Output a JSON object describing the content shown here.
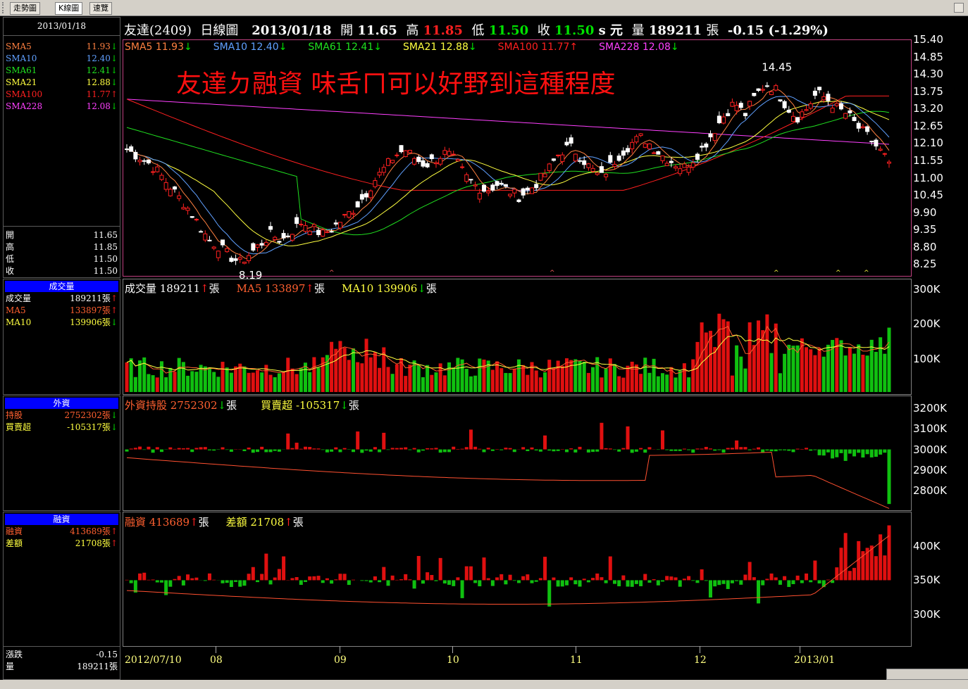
{
  "tabs": [
    {
      "label": "走勢圖",
      "active": false
    },
    {
      "label": "K線圖",
      "active": true
    },
    {
      "label": "速覽",
      "active": false
    }
  ],
  "header": {
    "stock": "友達(2409)",
    "period": "日線圖",
    "date": "2013/01/18",
    "open_label": "開",
    "open": "11.65",
    "high_label": "高",
    "high": "11.85",
    "low_label": "低",
    "low": "11.50",
    "close_label": "收",
    "close": "11.50",
    "unit": "s 元",
    "vol_label": "量",
    "volume": "189211",
    "vol_unit": "張",
    "change": "-0.15 (-1.29%)"
  },
  "overlay_text": "友達ㄉ融資 味舌ㄇ可以好野到這種程度",
  "sidebar": {
    "date": "2013/01/18",
    "sma": [
      {
        "name": "SMA5",
        "value": "11.93",
        "dir": "down",
        "color": "#ff8040"
      },
      {
        "name": "SMA10",
        "value": "12.40",
        "dir": "down",
        "color": "#60a0ff"
      },
      {
        "name": "SMA61",
        "value": "12.41",
        "dir": "down",
        "color": "#20e020"
      },
      {
        "name": "SMA21",
        "value": "12.88",
        "dir": "down",
        "color": "#ffff40"
      },
      {
        "name": "SMA100",
        "value": "11.77",
        "dir": "up",
        "color": "#ff2020"
      },
      {
        "name": "SMA228",
        "value": "12.08",
        "dir": "down",
        "color": "#ff40ff"
      }
    ],
    "ohlc": [
      {
        "k": "開",
        "v": "11.65"
      },
      {
        "k": "高",
        "v": "11.85"
      },
      {
        "k": "低",
        "v": "11.50"
      },
      {
        "k": "收",
        "v": "11.50"
      }
    ],
    "vol_title": "成交量",
    "vol": [
      {
        "k": "成交量",
        "v": "189211張",
        "dir": "up",
        "color": "#ffffff"
      },
      {
        "k": "MA5",
        "v": "133897張",
        "dir": "up",
        "color": "#ff6030"
      },
      {
        "k": "MA10",
        "v": "139906張",
        "dir": "down",
        "color": "#ffff40"
      }
    ],
    "foreign_title": "外資",
    "foreign": [
      {
        "k": "持股",
        "v": "2752302張",
        "dir": "down",
        "color": "#ff6030"
      },
      {
        "k": "買賣超",
        "v": "-105317張",
        "dir": "down",
        "color": "#ffff40"
      }
    ],
    "margin_title": "融資",
    "margin": [
      {
        "k": "融資",
        "v": "413689張",
        "dir": "up",
        "color": "#ff6030"
      },
      {
        "k": "差額",
        "v": "21708張",
        "dir": "up",
        "color": "#ffff40"
      }
    ],
    "bottom": [
      {
        "k": "漲跌",
        "v": "-0.15"
      },
      {
        "k": "量",
        "v": "189211張"
      }
    ]
  },
  "legends": {
    "sma_top": [
      {
        "text": "SMA5 11.93",
        "dir": "down",
        "color": "#ff8040"
      },
      {
        "text": "SMA10 12.40",
        "dir": "down",
        "color": "#60a0ff"
      },
      {
        "text": "SMA61 12.41",
        "dir": "down",
        "color": "#20e020"
      },
      {
        "text": "SMA21 12.88",
        "dir": "down",
        "color": "#ffff40"
      },
      {
        "text": "SMA100 11.77",
        "dir": "up",
        "color": "#ff2020"
      },
      {
        "text": "SMA228 12.08",
        "dir": "down",
        "color": "#ff40ff"
      }
    ],
    "vol": [
      {
        "text": "成交量 189211",
        "dir": "up",
        "unit": "張",
        "color": "#ffffff"
      },
      {
        "text": "MA5 133897",
        "dir": "up",
        "unit": "張",
        "color": "#ff6030"
      },
      {
        "text": "MA10 139906",
        "dir": "down",
        "unit": "張",
        "color": "#ffff40"
      }
    ],
    "foreign": [
      {
        "text": "外資持股 2752302",
        "dir": "down",
        "unit": "張",
        "color": "#ff6030"
      },
      {
        "text": "買賣超 -105317",
        "dir": "down",
        "unit": "張",
        "color": "#ffff40"
      }
    ],
    "margin": [
      {
        "text": "融資 413689",
        "dir": "up",
        "unit": "張",
        "color": "#ff6030"
      },
      {
        "text": "差額 21708",
        "dir": "up",
        "unit": "張",
        "color": "#ffff40"
      }
    ]
  },
  "chart_data": [
    {
      "type": "candlestick",
      "title": "友達(2409) 日線圖",
      "y_ticks": [
        "15.40",
        "14.85",
        "14.30",
        "13.75",
        "13.20",
        "12.65",
        "12.10",
        "11.55",
        "11.00",
        "10.45",
        "9.90",
        "9.35",
        "8.80",
        "8.25"
      ],
      "ylim": [
        7.9,
        15.4
      ],
      "annotations": [
        {
          "label": "14.45",
          "kind": "high"
        },
        {
          "label": "8.19",
          "kind": "low"
        }
      ],
      "x_ticks": [
        "2012/07/10",
        "08",
        "09",
        "10",
        "11",
        "12",
        "2013/01"
      ],
      "close_path": [
        11.9,
        11.7,
        11.5,
        11.2,
        10.8,
        10.4,
        10.0,
        9.5,
        9.0,
        8.8,
        8.5,
        8.3,
        8.6,
        8.9,
        9.2,
        9.0,
        9.3,
        9.6,
        9.4,
        9.2,
        9.4,
        9.7,
        10.0,
        10.4,
        10.9,
        11.3,
        11.7,
        11.9,
        11.6,
        11.4,
        11.6,
        11.8,
        11.5,
        11.0,
        10.7,
        10.6,
        10.8,
        10.6,
        10.4,
        10.6,
        10.9,
        11.3,
        11.8,
        12.0,
        11.7,
        11.3,
        11.0,
        11.4,
        11.8,
        12.1,
        12.3,
        12.0,
        11.7,
        11.5,
        11.3,
        11.6,
        12.0,
        12.5,
        13.0,
        13.4,
        13.0,
        13.6,
        14.0,
        13.8,
        13.3,
        12.9,
        13.2,
        13.7,
        13.5,
        13.2,
        13.0,
        12.6,
        12.3,
        11.9,
        11.5
      ]
    },
    {
      "type": "bar",
      "title": "成交量",
      "y_ticks": [
        "300K",
        "200K",
        "100K"
      ],
      "ylim": [
        0,
        330000
      ]
    },
    {
      "type": "bar",
      "title": "外資",
      "y_ticks": [
        "3200K",
        "3100K",
        "3000K",
        "2900K",
        "2800K"
      ],
      "ylim": [
        2710000,
        3260000
      ]
    },
    {
      "type": "bar",
      "title": "融資",
      "y_ticks": [
        "400K",
        "350K",
        "300K"
      ],
      "ylim": [
        255000,
        450000
      ]
    }
  ]
}
